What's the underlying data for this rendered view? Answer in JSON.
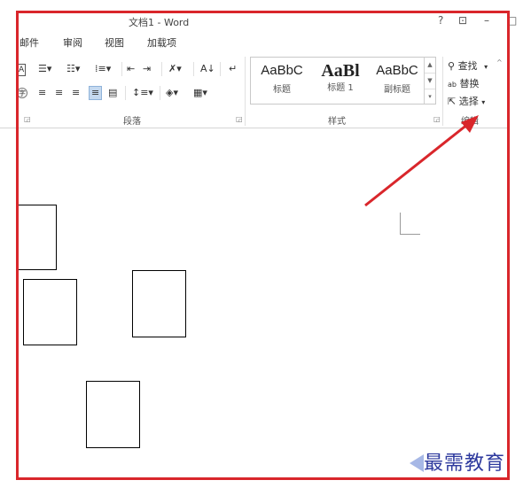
{
  "window": {
    "title": "文档1 - Word",
    "help": "?",
    "restore": "⊡",
    "minimize": "–",
    "max": "□"
  },
  "tabs": [
    "邮件",
    "审阅",
    "视图",
    "加载项"
  ],
  "ribbon": {
    "paragraph_label": "段落",
    "styles_label": "样式",
    "editing_label": "编辑",
    "styles": [
      {
        "sample": "AaBbC",
        "name": "标题"
      },
      {
        "sample": "AaBl",
        "name": "标题 1"
      },
      {
        "sample": "AaBbC",
        "name": "副标题"
      }
    ],
    "find": "查找",
    "replace": "替换",
    "select": "选择"
  },
  "watermark": "最需教育",
  "colors": {
    "frame": "#d9262b",
    "arrow": "#d9262b",
    "watermark": "#2e3a9e"
  }
}
